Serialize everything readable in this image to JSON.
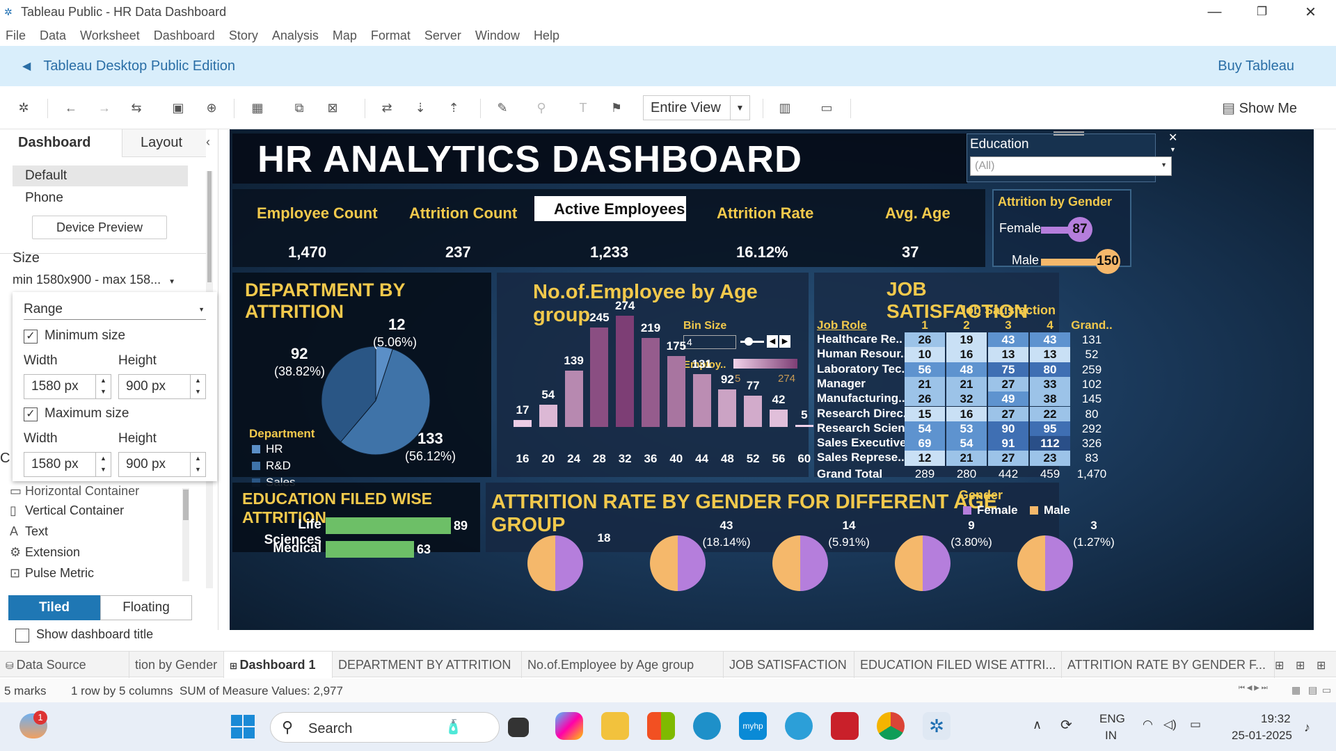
{
  "window": {
    "title": "Tableau Public - HR Data Dashboard",
    "controls": [
      "—",
      "❐",
      "✕"
    ]
  },
  "menu": [
    "File",
    "Data",
    "Worksheet",
    "Dashboard",
    "Story",
    "Analysis",
    "Map",
    "Format",
    "Server",
    "Window",
    "Help"
  ],
  "banner": {
    "text": "Tableau Desktop Public Edition",
    "buy": "Buy Tableau"
  },
  "toolbar": {
    "view_mode": "Entire View",
    "show_me": "Show Me"
  },
  "left_panel": {
    "tab_dashboard": "Dashboard",
    "tab_layout": "Layout",
    "collapse": "‹",
    "devices": [
      "Default",
      "Phone"
    ],
    "device_preview": "Device Preview",
    "size_label": "Size",
    "size_value": "min 1580x900 - max 158...",
    "range": "Range",
    "min_size_label": "Minimum size",
    "max_size_label": "Maximum size",
    "width_label": "Width",
    "height_label": "Height",
    "min_width": "1580 px",
    "min_height": "900 px",
    "max_width": "1580 px",
    "max_height": "900 px",
    "objects": [
      "Horizontal Container",
      "Vertical Container",
      "Text",
      "Extension",
      "Pulse Metric"
    ],
    "tiled": "Tiled",
    "floating": "Floating",
    "show_title": "Show dashboard title",
    "partial_letter": "C"
  },
  "dashboard": {
    "title": "HR ANALYTICS DASHBOARD",
    "education_filter": {
      "label": "Education",
      "value": "(All)"
    },
    "kpis": [
      {
        "label": "Employee Count",
        "value": "1,470"
      },
      {
        "label": "Attrition Count",
        "value": "237"
      },
      {
        "label": "Active Employees",
        "value": "1,233"
      },
      {
        "label": "Attrition Rate",
        "value": "16.12%"
      },
      {
        "label": "Avg. Age",
        "value": "37"
      }
    ],
    "attrition_by_gender": {
      "title": "Attrition by Gender",
      "rows": [
        {
          "label": "Female",
          "value": 87,
          "color": "#b57edc"
        },
        {
          "label": "Male",
          "value": 150,
          "color": "#f5b86b"
        }
      ]
    },
    "department": {
      "title": "DEPARTMENT BY ATTRITION",
      "legend_title": "Department",
      "slices": [
        {
          "name": "HR",
          "value": 12,
          "pct": "(5.06%)",
          "color": "#5b8fc7"
        },
        {
          "name": "R&D",
          "value": 133,
          "pct": "(56.12%)",
          "color": "#3f73a8"
        },
        {
          "name": "Sales",
          "value": 92,
          "pct": "(38.82%)",
          "color": "#2a5685"
        }
      ]
    },
    "age_group": {
      "title": "No.of.Employee by Age group",
      "bin_label": "Bin Size",
      "bin_value": "4",
      "legend_label": "Employ..",
      "legend_min": "5",
      "legend_max": "274"
    },
    "job_satisfaction": {
      "title": "JOB SATISFACTION",
      "col_group": "Job Satisfaction",
      "row_header": "Job Role",
      "columns": [
        "1",
        "2",
        "3",
        "4",
        "Grand.."
      ],
      "rows": [
        {
          "role": "Healthcare Re..",
          "vals": [
            26,
            19,
            43,
            43
          ],
          "total": "131"
        },
        {
          "role": "Human Resour..",
          "vals": [
            10,
            16,
            13,
            13
          ],
          "total": "52"
        },
        {
          "role": "Laboratory Tec..",
          "vals": [
            56,
            48,
            75,
            80
          ],
          "total": "259"
        },
        {
          "role": "Manager",
          "vals": [
            21,
            21,
            27,
            33
          ],
          "total": "102"
        },
        {
          "role": "Manufacturing..",
          "vals": [
            26,
            32,
            49,
            38
          ],
          "total": "145"
        },
        {
          "role": "Research Direc..",
          "vals": [
            15,
            16,
            27,
            22
          ],
          "total": "80"
        },
        {
          "role": "Research Scien..",
          "vals": [
            54,
            53,
            90,
            95
          ],
          "total": "292"
        },
        {
          "role": "Sales Executive",
          "vals": [
            69,
            54,
            91,
            112
          ],
          "total": "326"
        },
        {
          "role": "Sales Represe..",
          "vals": [
            12,
            21,
            27,
            23
          ],
          "total": "83"
        }
      ],
      "grand_total": {
        "label": "Grand Total",
        "vals": [
          "289",
          "280",
          "442",
          "459"
        ],
        "total": "1,470"
      }
    },
    "education_field": {
      "title": "EDUCATION FILED WISE ATTRITION",
      "rows": [
        {
          "label": "Life Sciences",
          "value": 89
        },
        {
          "label": "Medical",
          "value": 63
        }
      ]
    },
    "gender_age": {
      "title": "ATTRITION RATE BY GENDER FOR DIFFERENT AGE GROUP",
      "legend_title": "Gender",
      "legend": [
        {
          "name": "Female",
          "color": "#b57edc"
        },
        {
          "name": "Male",
          "color": "#f5b86b"
        }
      ],
      "pies": [
        {
          "value": "18",
          "pct": ""
        },
        {
          "value": "43",
          "pct": "(18.14%)"
        },
        {
          "value": "14",
          "pct": "(5.91%)"
        },
        {
          "value": "9",
          "pct": "(3.80%)"
        },
        {
          "value": "3",
          "pct": "(1.27%)"
        }
      ]
    }
  },
  "chart_data": {
    "type": "bar",
    "title": "No.of.Employee by Age group",
    "categories": [
      "16",
      "20",
      "24",
      "28",
      "32",
      "36",
      "40",
      "44",
      "48",
      "52",
      "56",
      "60"
    ],
    "values": [
      17,
      54,
      139,
      245,
      274,
      219,
      175,
      131,
      92,
      77,
      42,
      5
    ],
    "xlabel": "",
    "ylabel": "",
    "color_range": [
      "#f1d3ea",
      "#7d3e75"
    ]
  },
  "sheet_tabs": [
    "Data Source",
    "tion by Gender",
    "Dashboard 1",
    "DEPARTMENT BY ATTRITION",
    "No.of.Employee by Age group",
    "JOB SATISFACTION",
    "EDUCATION FILED WISE ATTRI...",
    "ATTRITION RATE BY GENDER F..."
  ],
  "status": {
    "marks": "5 marks",
    "rows": "1 row by 5 columns",
    "sum": "SUM of Measure Values: 2,977"
  },
  "taskbar": {
    "search": "Search",
    "lang1": "ENG",
    "lang2": "IN",
    "time": "19:32",
    "date": "25-01-2025",
    "notif_badge": "1"
  }
}
